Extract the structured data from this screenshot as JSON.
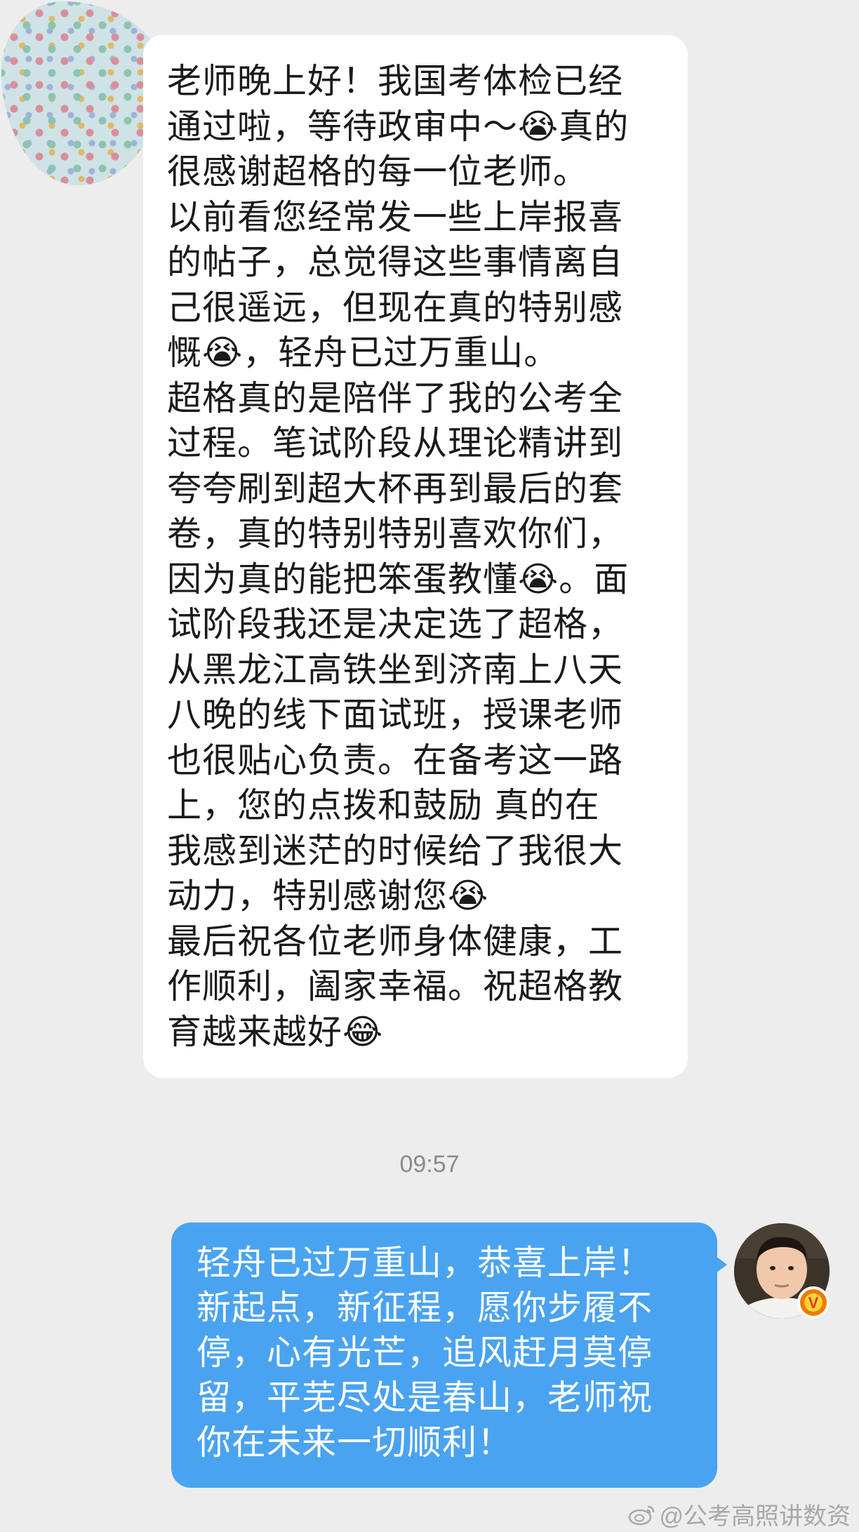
{
  "chat": {
    "incoming": {
      "lines": [
        "老师晚上好！我国考体检已经",
        "通过啦，等待政审中～😭真的",
        "很感谢超格的每一位老师。",
        "以前看您经常发一些上岸报喜",
        "的帖子，总觉得这些事情离自",
        "己很遥远，但现在真的特别感",
        "慨😭，轻舟已过万重山。",
        "超格真的是陪伴了我的公考全",
        "过程。笔试阶段从理论精讲到",
        "夸夸刷到超大杯再到最后的套",
        "卷，真的特别特别喜欢你们，",
        "因为真的能把笨蛋教懂😭。面",
        "试阶段我还是决定选了超格，",
        "从黑龙江高铁坐到济南上八天",
        "八晚的线下面试班，授课老师",
        "也很贴心负责。在备考这一路",
        "上，您的点拨和鼓励 真的在",
        "我感到迷茫的时候给了我很大",
        "动力，特别感谢您😭",
        "最后祝各位老师身体健康，工",
        "作顺利，阖家幸福。祝超格教",
        "育越来越好😂"
      ]
    },
    "timestamp": "09:57",
    "outgoing": {
      "lines": [
        "轻舟已过万重山，恭喜上岸！",
        "新起点，新征程，愿你步履不",
        "停，心有光芒，追风赶月莫停",
        "留，平芜尽处是春山，老师祝",
        "你在未来一切顺利！"
      ]
    },
    "avatar_badge": "V"
  },
  "watermark": {
    "text": "@公考高照讲数资",
    "icon": "weibo-icon"
  },
  "colors": {
    "background": "#ededed",
    "incoming_bubble": "#ffffff",
    "outgoing_bubble": "#4aa3f0",
    "badge": "#f07a00"
  }
}
